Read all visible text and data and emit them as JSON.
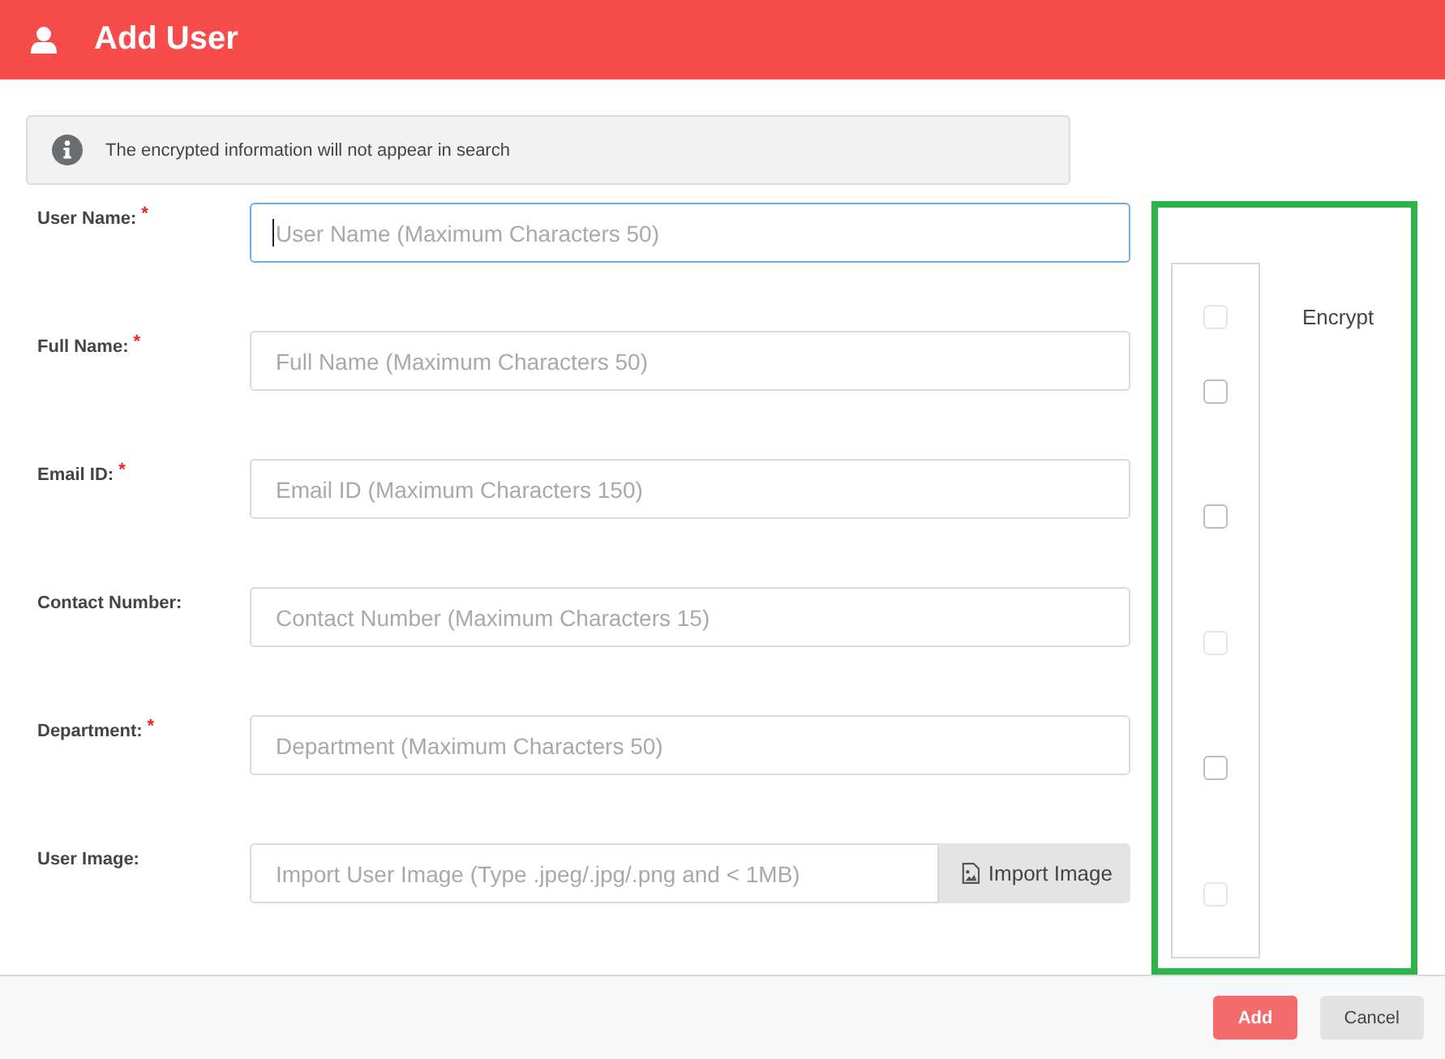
{
  "header": {
    "title": "Add User"
  },
  "notice": {
    "text": "The encrypted information will not appear in search"
  },
  "fields": [
    {
      "label": "User Name:",
      "required_mark": "*",
      "placeholder": "User Name (Maximum Characters 50)",
      "focused": true
    },
    {
      "label": "Full Name:",
      "required_mark": "*",
      "placeholder": "Full Name (Maximum Characters 50)",
      "focused": false
    },
    {
      "label": "Email ID:",
      "required_mark": "*",
      "placeholder": "Email ID (Maximum Characters 150)",
      "focused": false
    },
    {
      "label": "Contact Number:",
      "placeholder": "Contact Number (Maximum Characters 15)",
      "focused": false
    },
    {
      "label": "Department:",
      "required_mark": "*",
      "placeholder": "Department (Maximum Characters 50)",
      "focused": false
    },
    {
      "label": "User Image:",
      "placeholder": "Import User Image (Type .jpeg/.jpg/.png and < 1MB)",
      "focused": false,
      "action": "Import Image"
    }
  ],
  "encrypt": {
    "label": "Encrypt",
    "header_checkbox": {
      "checked": false,
      "disabled": true
    },
    "checkboxes": [
      {
        "checked": false,
        "disabled": false
      },
      {
        "checked": false,
        "disabled": false
      },
      {
        "checked": false,
        "disabled": true
      },
      {
        "checked": false,
        "disabled": false
      },
      {
        "checked": false,
        "disabled": true
      }
    ]
  },
  "buttons": [
    {
      "label": "Add",
      "kind": "primary"
    },
    {
      "label": "Cancel",
      "kind": "secondary"
    }
  ]
}
